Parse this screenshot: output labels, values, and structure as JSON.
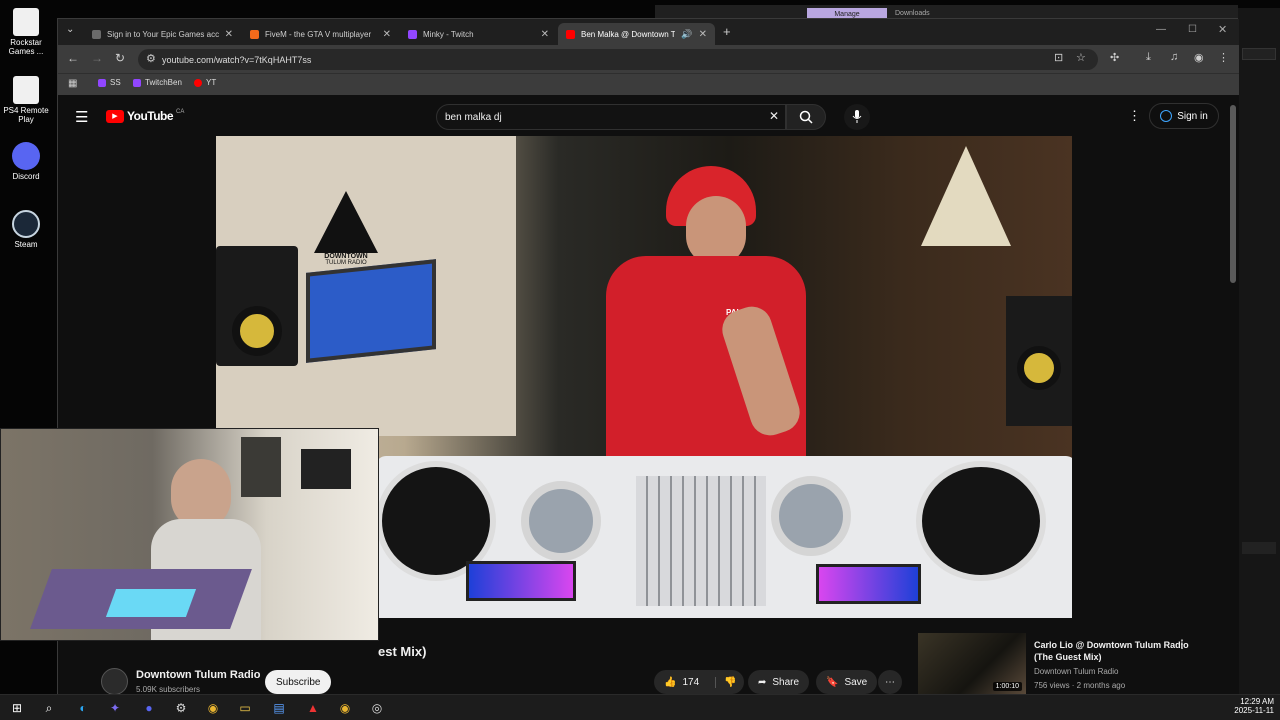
{
  "desktop": {
    "icons": [
      {
        "label": "Rockstar Games ..."
      },
      {
        "label": "PS4 Remote Play"
      },
      {
        "label": "Discord"
      },
      {
        "label": "Steam"
      }
    ],
    "bg_window": {
      "tab_label": "Manage",
      "title": "Downloads"
    }
  },
  "browser": {
    "tabs": [
      {
        "title": "Sign in to Your Epic Games acc",
        "color": "#6b6b6b"
      },
      {
        "title": "FiveM - the GTA V multiplayer",
        "color": "#f26a1b"
      },
      {
        "title": "Minky - Twitch",
        "color": "#9146ff"
      },
      {
        "title": "Ben Malka @ Downtown Tu",
        "color": "#ff0000"
      }
    ],
    "new_tab": "+",
    "url": "youtube.com/watch?v=7tKqHAHT7ss",
    "bookmarks": [
      {
        "label": "SS",
        "color": "#9146ff"
      },
      {
        "label": "TwitchBen",
        "color": "#9146ff"
      },
      {
        "label": "YT",
        "color": "#ff0000"
      }
    ]
  },
  "youtube": {
    "logo": "YouTube",
    "country": "CA",
    "search_value": "ben malka dj",
    "sign_in": "Sign in",
    "video_title_visible": "est Mix)",
    "channel": {
      "name": "Downtown Tulum Radio",
      "subs": "5.09K subscribers"
    },
    "subscribe": "Subscribe",
    "likes": "174",
    "share": "Share",
    "save": "Save",
    "overlay_logo": {
      "line1": "DOWNTOWN",
      "line2": "TULUM RADIO"
    },
    "shirt_text": "PALMA CENTER",
    "recommended": [
      {
        "title": "Carlo Lio @ Downtown Tulum Radio (The Guest Mix)",
        "channel": "Downtown Tulum Radio",
        "meta": "756 views · 2 months ago",
        "duration": "1:00:10"
      }
    ]
  },
  "taskbar": {
    "time": "12:29 AM",
    "date": "2025-11-11"
  }
}
